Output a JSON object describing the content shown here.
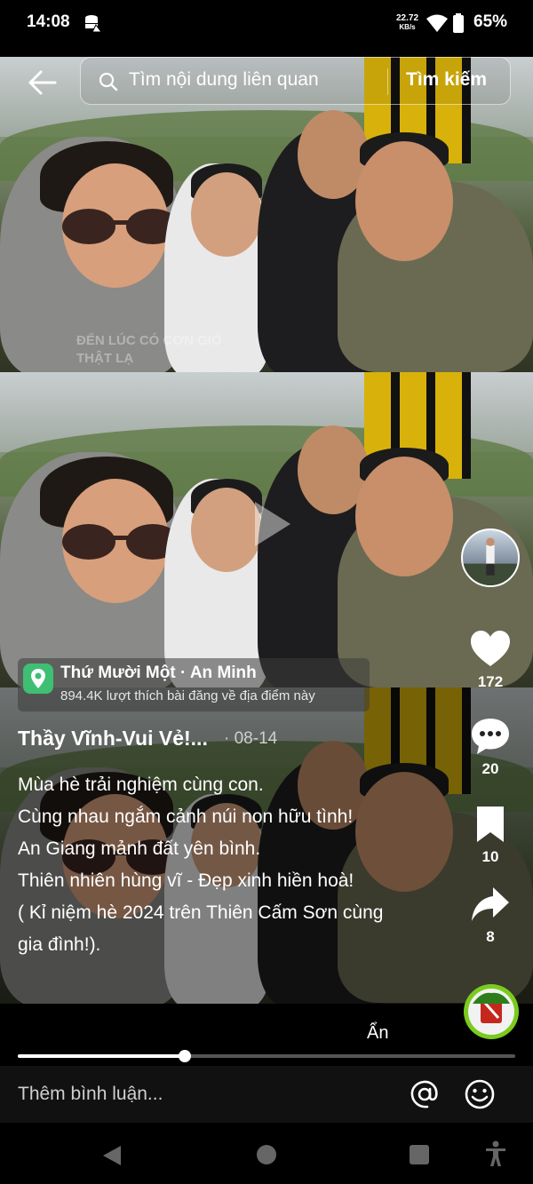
{
  "status_bar": {
    "time": "14:08",
    "net_speed_value": "22.72",
    "net_speed_unit": "KB/s",
    "battery": "65%"
  },
  "search": {
    "placeholder": "Tìm nội dung liên quan",
    "button_label": "Tìm kiếm"
  },
  "video": {
    "watermark": "ĐẾN LÚC CÓ CƠN GIÓ THẬT LẠ"
  },
  "actions": {
    "likes": "172",
    "comments": "20",
    "saves": "10",
    "shares": "8"
  },
  "location": {
    "name": "Thứ Mười Một · An Minh",
    "subtitle": "894.4K lượt thích bài đăng về địa điểm này"
  },
  "post": {
    "author": "Thầy Vĩnh-Vui Vẻ!...",
    "date": "· 08-14",
    "caption": "Mùa hè trải nghiệm cùng con.\nCùng nhau ngắm cảnh núi non hữu tình!\nAn Giang mảnh đất yên bình.\nThiên nhiên hùng vĩ - Đẹp xinh hiền hoà!\n( Kỉ niệm hè 2024 trên Thiên Cấm Sơn cùng gia đình!).",
    "hide_label": "Ẩn"
  },
  "playback": {
    "progress_fraction": 0.335
  },
  "comment": {
    "placeholder": "Thêm bình luận..."
  },
  "colors": {
    "location_icon": "#3fbf73",
    "sound_disc": "#7acb1d"
  }
}
